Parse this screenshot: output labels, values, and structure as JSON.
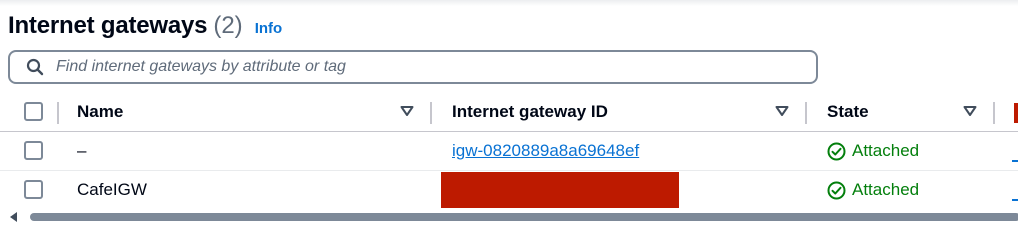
{
  "header": {
    "title": "Internet gateways",
    "count": "(2)",
    "info_link": "Info"
  },
  "search": {
    "placeholder": "Find internet gateways by attribute or tag"
  },
  "table": {
    "columns": [
      "Name",
      "Internet gateway ID",
      "State"
    ],
    "rows": [
      {
        "name": "–",
        "gateway_id": "igw-0820889a8a69648ef",
        "state": "Attached"
      },
      {
        "name": "CafeIGW",
        "gateway_id": "",
        "state": "Attached"
      }
    ]
  },
  "colors": {
    "link": "#0972d3",
    "success": "#037f0c",
    "redaction": "#bd1a00",
    "border": "#7d8998"
  },
  "icons": {
    "search": "search-icon",
    "sort": "sort-caret-icon",
    "status": "check-circle-icon"
  }
}
